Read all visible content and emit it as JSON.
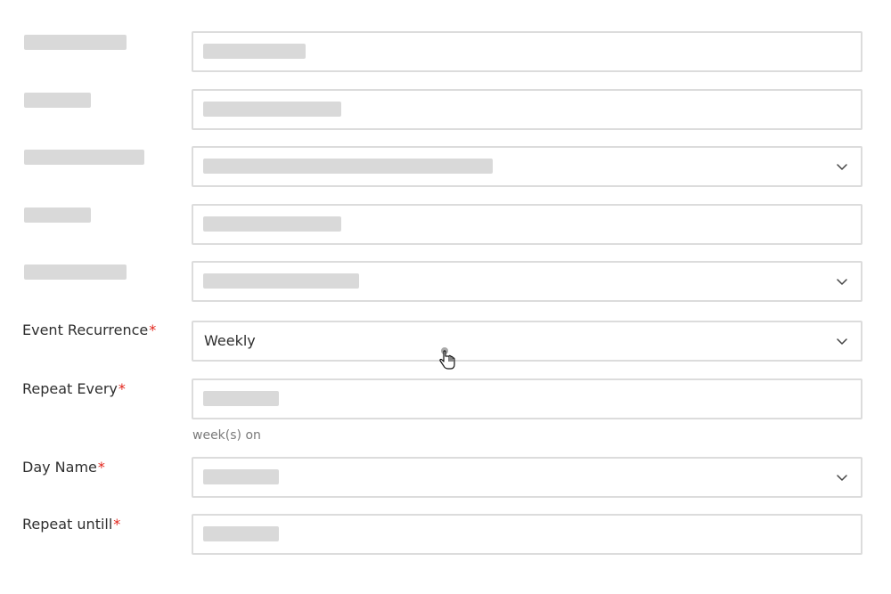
{
  "form": {
    "event_recurrence": {
      "label": "Event Recurrence",
      "required_mark": "*",
      "value": "Weekly"
    },
    "repeat_every": {
      "label": "Repeat Every",
      "required_mark": "*",
      "helper": "week(s) on"
    },
    "day_name": {
      "label": "Day Name",
      "required_mark": "*"
    },
    "repeat_until": {
      "label": "Repeat untill",
      "required_mark": "*"
    }
  },
  "icons": {
    "dropdown": "chevron-down-icon",
    "cursor": "hand-pointer-cursor-icon"
  },
  "colors": {
    "required": "#e2231a",
    "border": "#dcdcdc",
    "placeholder_block": "#d9d9d9"
  }
}
